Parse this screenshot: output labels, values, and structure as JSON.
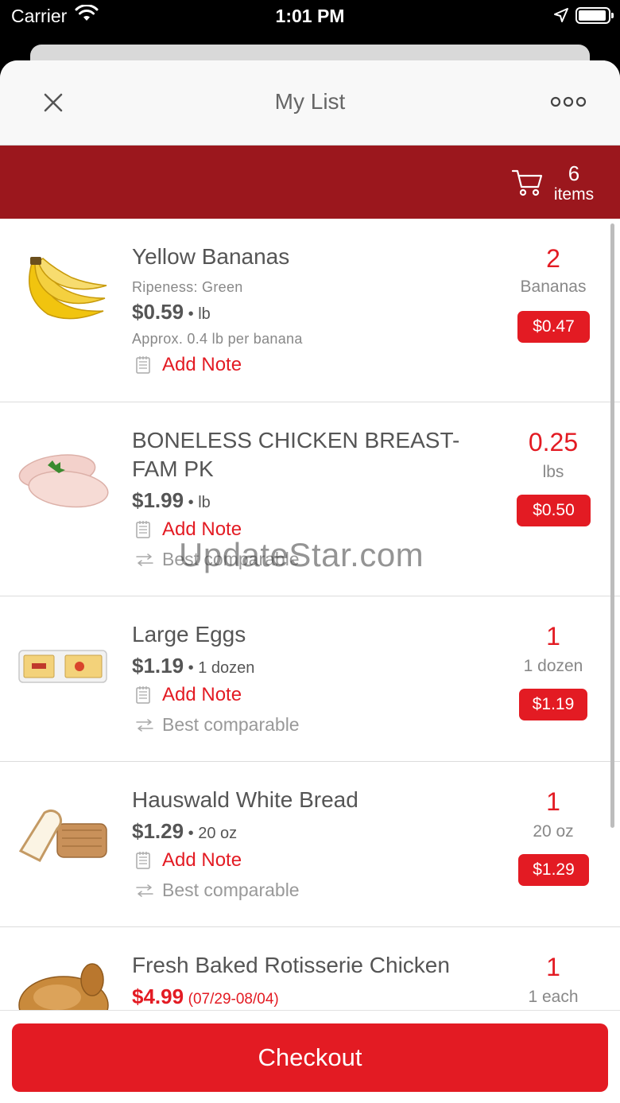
{
  "status_bar": {
    "carrier": "Carrier",
    "time": "1:01 PM"
  },
  "nav": {
    "title": "My List"
  },
  "cart": {
    "count": "6",
    "label": "items"
  },
  "items": [
    {
      "name": "Yellow Bananas",
      "attribute": "Ripeness: Green",
      "price": "$0.59",
      "unit_price": "lb",
      "approx": "Approx. 0.4 lb per banana",
      "note_label": "Add Note",
      "quantity": "2",
      "quantity_unit": "Bananas",
      "total": "$0.47"
    },
    {
      "name": "BONELESS CHICKEN BREAST-FAM PK",
      "price": "$1.99",
      "unit_price": "lb",
      "note_label": "Add Note",
      "comparable_label": "Best comparable",
      "quantity": "0.25",
      "quantity_unit": "lbs",
      "total": "$0.50"
    },
    {
      "name": "Large Eggs",
      "price": "$1.19",
      "unit_price": "1 dozen",
      "note_label": "Add Note",
      "comparable_label": "Best comparable",
      "quantity": "1",
      "quantity_unit": "1 dozen",
      "total": "$1.19"
    },
    {
      "name": "Hauswald White Bread",
      "price": "$1.29",
      "unit_price": "20 oz",
      "note_label": "Add Note",
      "comparable_label": "Best comparable",
      "quantity": "1",
      "quantity_unit": "20 oz",
      "total": "$1.29"
    },
    {
      "name": "Fresh Baked Rotisserie Chicken",
      "price": "$4.99",
      "sale_dates": "(07/29-08/04)",
      "quantity": "1",
      "quantity_unit": "1 each"
    }
  ],
  "watermark": "UpdateStar.com",
  "footer": {
    "checkout_label": "Checkout"
  },
  "colors": {
    "accent_red": "#e31b23",
    "banner_dark_red": "#9b171d"
  }
}
